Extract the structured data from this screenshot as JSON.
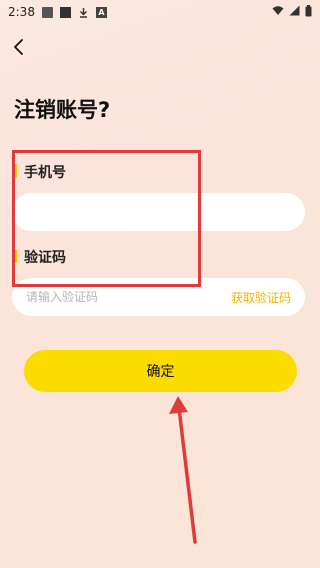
{
  "status_bar": {
    "time": "2:38",
    "left_icons": [
      "image-icon",
      "square-icon",
      "download-icon",
      "a-icon"
    ],
    "right_icons": [
      "wifi-icon",
      "signal-icon",
      "battery-icon"
    ]
  },
  "header": {
    "back_icon": "chevron-left-icon"
  },
  "page": {
    "title": "注销账号?"
  },
  "form": {
    "phone_label": "手机号",
    "phone_value": "",
    "phone_placeholder": "",
    "code_label": "验证码",
    "code_value": "",
    "code_placeholder": "请输入验证码",
    "get_code_label": "获取验证码"
  },
  "actions": {
    "confirm_label": "确定"
  },
  "colors": {
    "accent": "#fbdb00",
    "label_bar": "#f7c400",
    "get_code_text": "#f0b400",
    "annotation": "#e03b3b"
  }
}
